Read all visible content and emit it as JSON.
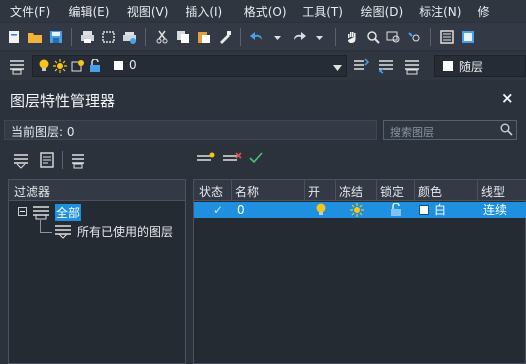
{
  "menubar": {
    "items": [
      "文件(F)",
      "编辑(E)",
      "视图(V)",
      "插入(I)",
      "格式(O)",
      "工具(T)",
      "绘图(D)",
      "标注(N)",
      "修"
    ]
  },
  "toolbar": {
    "icons": [
      "new-file-icon",
      "open-folder-icon",
      "save-icon",
      "print-icon",
      "print-preview-icon",
      "publish-icon",
      "cut-icon",
      "copy-icon",
      "paste-icon",
      "match-properties-icon",
      "undo-icon",
      "redo-icon",
      "pan-icon",
      "zoom-realtime-icon",
      "zoom-window-icon",
      "zoom-previous-icon",
      "properties-icon",
      "design-center-icon"
    ]
  },
  "layerbar": {
    "current_layer_value": "0",
    "color_value": "随层"
  },
  "panel": {
    "title": "图层特性管理器",
    "close_glyph": "×",
    "current_layer_label": "当前图层: 0",
    "search_placeholder": "搜索图层",
    "filters_header": "过滤器",
    "tree_root": "全部",
    "tree_child": "所有已使用的图层"
  },
  "grid": {
    "headers": [
      "状态",
      "名称",
      "开",
      "冻结",
      "锁定",
      "颜色",
      "线型"
    ],
    "rows": [
      {
        "status": "✓",
        "name": "0",
        "on": "bulb-on-icon",
        "freeze": "sun-icon",
        "lock": "unlock-icon",
        "color_name": "白",
        "linetype": "连续"
      }
    ]
  },
  "colors": {
    "accent": "#1f8fe0",
    "background": "#2b323c",
    "bulb": "#f5c518"
  }
}
